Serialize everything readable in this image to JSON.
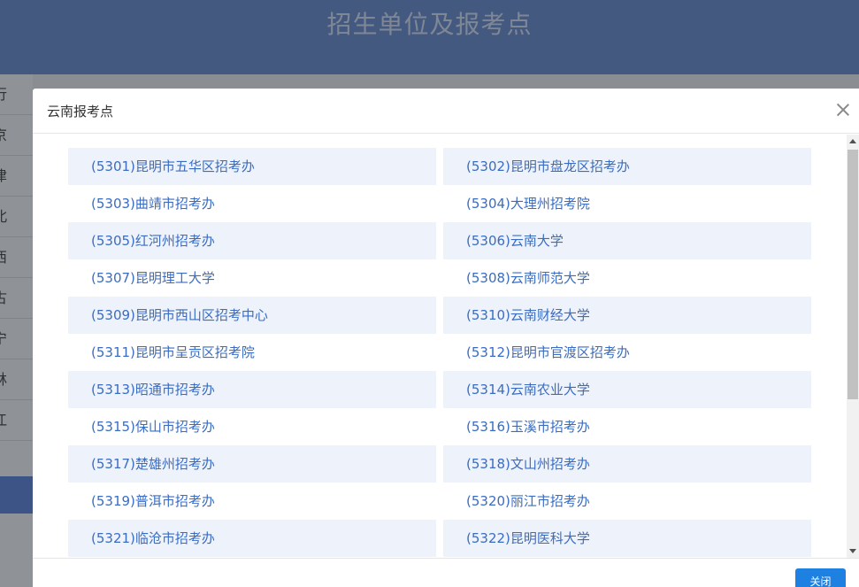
{
  "page": {
    "title": "招生单位及报考点"
  },
  "sidebar": {
    "items": [
      "行",
      "京",
      "津",
      "北",
      "西",
      "古",
      "宁",
      "林",
      "江"
    ]
  },
  "modal": {
    "title": "云南报考点",
    "close_button": "关闭",
    "points": [
      "(5301)昆明市五华区招考办",
      "(5302)昆明市盘龙区招考办",
      "(5303)曲靖市招考办",
      "(5304)大理州招考院",
      "(5305)红河州招考办",
      "(5306)云南大学",
      "(5307)昆明理工大学",
      "(5308)云南师范大学",
      "(5309)昆明市西山区招考中心",
      "(5310)云南财经大学",
      "(5311)昆明市呈贡区招考院",
      "(5312)昆明市官渡区招考办",
      "(5313)昭通市招考办",
      "(5314)云南农业大学",
      "(5315)保山市招考办",
      "(5316)玉溪市招考办",
      "(5317)楚雄州招考办",
      "(5318)文山州招考办",
      "(5319)普洱市招考办",
      "(5320)丽江市招考办",
      "(5321)临沧市招考办",
      "(5322)昆明医科大学"
    ]
  }
}
